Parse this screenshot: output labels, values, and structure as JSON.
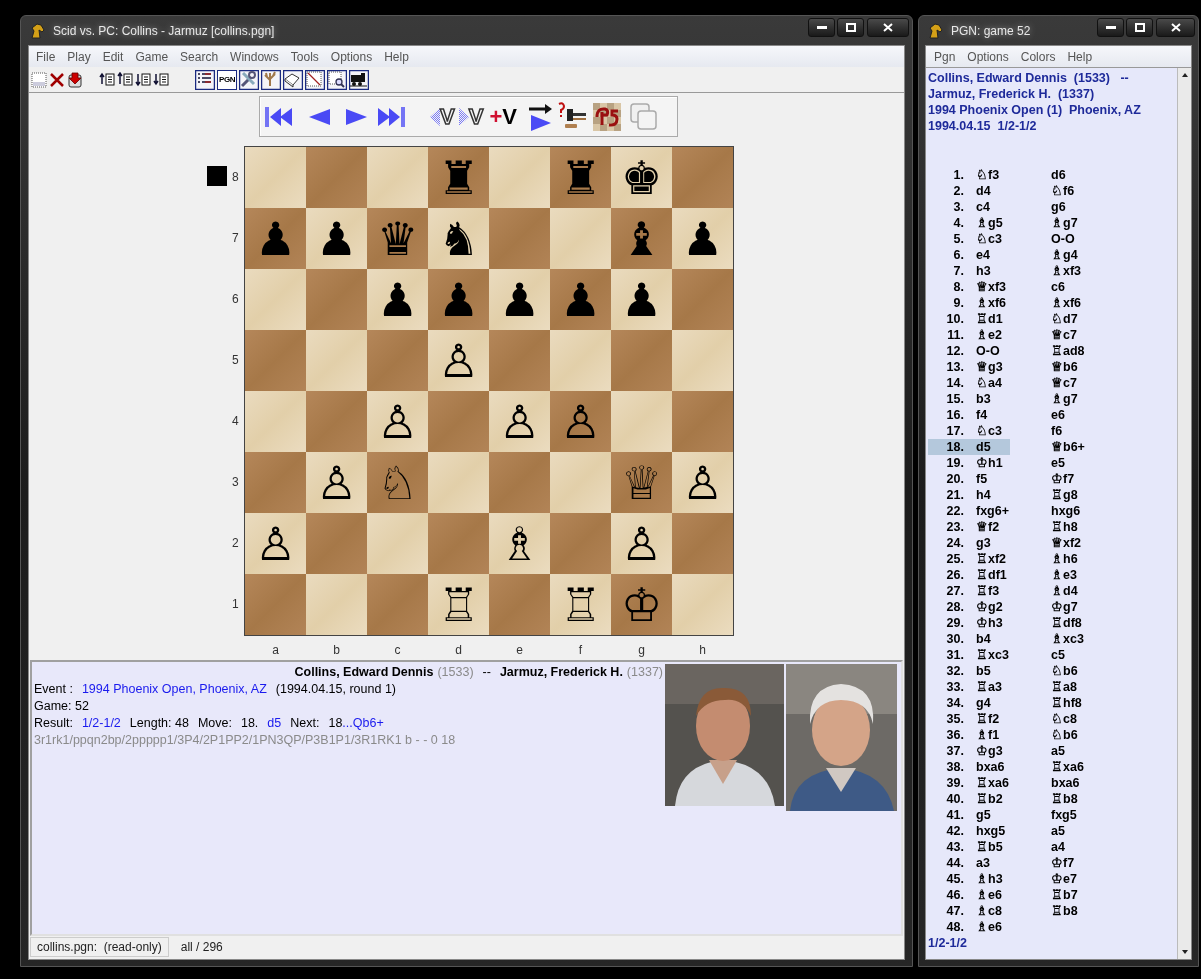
{
  "main_window": {
    "title": "Scid vs. PC: Collins - Jarmuz [collins.pgn]",
    "menu": [
      "File",
      "Play",
      "Edit",
      "Game",
      "Search",
      "Windows",
      "Tools",
      "Options",
      "Help"
    ],
    "pgn_button_label": "PGN",
    "nav_buttons": [
      {
        "kind": "start"
      },
      {
        "kind": "back"
      },
      {
        "kind": "forward"
      },
      {
        "kind": "end"
      },
      {
        "kind": "var-back",
        "label": "V"
      },
      {
        "kind": "var-forward",
        "label": "V"
      },
      {
        "kind": "add-var",
        "label": "+V"
      },
      {
        "kind": "auto"
      },
      {
        "kind": "engine"
      },
      {
        "kind": "flip"
      },
      {
        "kind": "windows"
      }
    ],
    "board": {
      "black_to_move": true,
      "rank_labels": [
        "8",
        "7",
        "6",
        "5",
        "4",
        "3",
        "2",
        "1"
      ],
      "file_labels": [
        "a",
        "b",
        "c",
        "d",
        "e",
        "f",
        "g",
        "h"
      ],
      "rows": [
        [
          null,
          null,
          null,
          "♜",
          null,
          "♜",
          "♚",
          null
        ],
        [
          "♟",
          "♟",
          "♛",
          "♞",
          null,
          null,
          "♝",
          "♟"
        ],
        [
          null,
          null,
          "♟",
          "♟",
          "♟",
          "♟",
          "♟",
          null
        ],
        [
          null,
          null,
          null,
          "♙",
          null,
          null,
          null,
          null
        ],
        [
          null,
          null,
          "♙",
          null,
          "♙",
          "♙",
          null,
          null
        ],
        [
          null,
          "♙",
          "♘",
          null,
          null,
          null,
          "♕",
          "♙"
        ],
        [
          "♙",
          null,
          null,
          null,
          "♗",
          null,
          "♙",
          null
        ],
        [
          null,
          null,
          null,
          "♖",
          null,
          "♖",
          "♔",
          null
        ]
      ]
    },
    "info": {
      "lines": [
        [
          {
            "text": "Collins, Edward Dennis",
            "kind": "player"
          },
          {
            "text": "(1533)",
            "kind": "rating"
          },
          {
            "text": "--",
            "kind": "label"
          },
          {
            "text": "Jarmuz, Frederick H.",
            "kind": "player"
          },
          {
            "text": "(1337)",
            "kind": "rating"
          }
        ],
        [
          {
            "text": "Event :",
            "kind": "label"
          },
          {
            "text": "1994 Phoenix Open, Phoenix, AZ",
            "kind": "link"
          },
          {
            "text": "(1994.04.15, round 1)",
            "kind": "label"
          }
        ],
        [
          {
            "text": "Game: 52",
            "kind": "label"
          }
        ],
        [
          {
            "text": "Result:",
            "kind": "label"
          },
          {
            "text": "1/2-1/2",
            "kind": "link"
          },
          {
            "text": "Length: 48",
            "kind": "label"
          },
          {
            "text": "Move:",
            "kind": "label"
          },
          {
            "text": "18.",
            "kind": "label"
          },
          {
            "text": "d5",
            "kind": "link"
          },
          {
            "text": "Next:",
            "kind": "label"
          },
          {
            "text": "18",
            "kind": "next-number"
          },
          {
            "text": "...Qb6+",
            "kind": "next-move"
          }
        ],
        [
          {
            "text": "3r1rk1/ppqn2bp/2ppppp1/3P4/2P1PP2/1PN3QP/P3B1P1/3R1RK1 b - - 0 18",
            "kind": "fen"
          }
        ]
      ],
      "photos": [
        {
          "kind": "picture"
        },
        {
          "kind": "picture"
        }
      ]
    },
    "status_bar": [
      "collins.pgn:  (read-only)",
      "all / 296"
    ]
  },
  "pgn_window": {
    "title": "PGN: game 52",
    "menu": [
      "Pgn",
      "Options",
      "Colors",
      "Help"
    ],
    "header": [
      "Collins, Edward Dennis  (1533)   --",
      "Jarmuz, Frederick H.  (1337)",
      "1994 Phoenix Open (1)  Phoenix, AZ",
      "1994.04.15  1/2-1/2"
    ],
    "moves": [
      {
        "number": "1.",
        "white": "♘f3",
        "black": "d6",
        "selected": false
      },
      {
        "number": "2.",
        "white": "d4",
        "black": "♘f6",
        "selected": false
      },
      {
        "number": "3.",
        "white": "c4",
        "black": "g6",
        "selected": false
      },
      {
        "number": "4.",
        "white": "♗g5",
        "black": "♗g7",
        "selected": false
      },
      {
        "number": "5.",
        "white": "♘c3",
        "black": "O-O",
        "selected": false
      },
      {
        "number": "6.",
        "white": "e4",
        "black": "♗g4",
        "selected": false
      },
      {
        "number": "7.",
        "white": "h3",
        "black": "♗xf3",
        "selected": false
      },
      {
        "number": "8.",
        "white": "♕xf3",
        "black": "c6",
        "selected": false
      },
      {
        "number": "9.",
        "white": "♗xf6",
        "black": "♗xf6",
        "selected": false
      },
      {
        "number": "10.",
        "white": "♖d1",
        "black": "♘d7",
        "selected": false
      },
      {
        "number": "11.",
        "white": "♗e2",
        "black": "♕c7",
        "selected": false
      },
      {
        "number": "12.",
        "white": "O-O",
        "black": "♖ad8",
        "selected": false
      },
      {
        "number": "13.",
        "white": "♕g3",
        "black": "♕b6",
        "selected": false
      },
      {
        "number": "14.",
        "white": "♘a4",
        "black": "♕c7",
        "selected": false
      },
      {
        "number": "15.",
        "white": "b3",
        "black": "♗g7",
        "selected": false
      },
      {
        "number": "16.",
        "white": "f4",
        "black": "e6",
        "selected": false
      },
      {
        "number": "17.",
        "white": "♘c3",
        "black": "f6",
        "selected": false
      },
      {
        "number": "18.",
        "white": "d5",
        "black": "♕b6+",
        "selected": true
      },
      {
        "number": "19.",
        "white": "♔h1",
        "black": "e5",
        "selected": false
      },
      {
        "number": "20.",
        "white": "f5",
        "black": "♔f7",
        "selected": false
      },
      {
        "number": "21.",
        "white": "h4",
        "black": "♖g8",
        "selected": false
      },
      {
        "number": "22.",
        "white": "fxg6+",
        "black": "hxg6",
        "selected": false
      },
      {
        "number": "23.",
        "white": "♕f2",
        "black": "♖h8",
        "selected": false
      },
      {
        "number": "24.",
        "white": "g3",
        "black": "♕xf2",
        "selected": false
      },
      {
        "number": "25.",
        "white": "♖xf2",
        "black": "♗h6",
        "selected": false
      },
      {
        "number": "26.",
        "white": "♖df1",
        "black": "♗e3",
        "selected": false
      },
      {
        "number": "27.",
        "white": "♖f3",
        "black": "♗d4",
        "selected": false
      },
      {
        "number": "28.",
        "white": "♔g2",
        "black": "♔g7",
        "selected": false
      },
      {
        "number": "29.",
        "white": "♔h3",
        "black": "♖df8",
        "selected": false
      },
      {
        "number": "30.",
        "white": "b4",
        "black": "♗xc3",
        "selected": false
      },
      {
        "number": "31.",
        "white": "♖xc3",
        "black": "c5",
        "selected": false
      },
      {
        "number": "32.",
        "white": "b5",
        "black": "♘b6",
        "selected": false
      },
      {
        "number": "33.",
        "white": "♖a3",
        "black": "♖a8",
        "selected": false
      },
      {
        "number": "34.",
        "white": "g4",
        "black": "♖hf8",
        "selected": false
      },
      {
        "number": "35.",
        "white": "♖f2",
        "black": "♘c8",
        "selected": false
      },
      {
        "number": "36.",
        "white": "♗f1",
        "black": "♘b6",
        "selected": false
      },
      {
        "number": "37.",
        "white": "♔g3",
        "black": "a5",
        "selected": false
      },
      {
        "number": "38.",
        "white": "bxa6",
        "black": "♖xa6",
        "selected": false
      },
      {
        "number": "39.",
        "white": "♖xa6",
        "black": "bxa6",
        "selected": false
      },
      {
        "number": "40.",
        "white": "♖b2",
        "black": "♖b8",
        "selected": false
      },
      {
        "number": "41.",
        "white": "g5",
        "black": "fxg5",
        "selected": false
      },
      {
        "number": "42.",
        "white": "hxg5",
        "black": "a5",
        "selected": false
      },
      {
        "number": "43.",
        "white": "♖b5",
        "black": "a4",
        "selected": false
      },
      {
        "number": "44.",
        "white": "a3",
        "black": "♔f7",
        "selected": false
      },
      {
        "number": "45.",
        "white": "♗h3",
        "black": "♔e7",
        "selected": false
      },
      {
        "number": "46.",
        "white": "♗e6",
        "black": "♖b7",
        "selected": false
      },
      {
        "number": "47.",
        "white": "♗c8",
        "black": "♖b8",
        "selected": false
      },
      {
        "number": "48.",
        "white": "♗e6",
        "selected": false
      }
    ],
    "result": "1/2-1/2"
  }
}
